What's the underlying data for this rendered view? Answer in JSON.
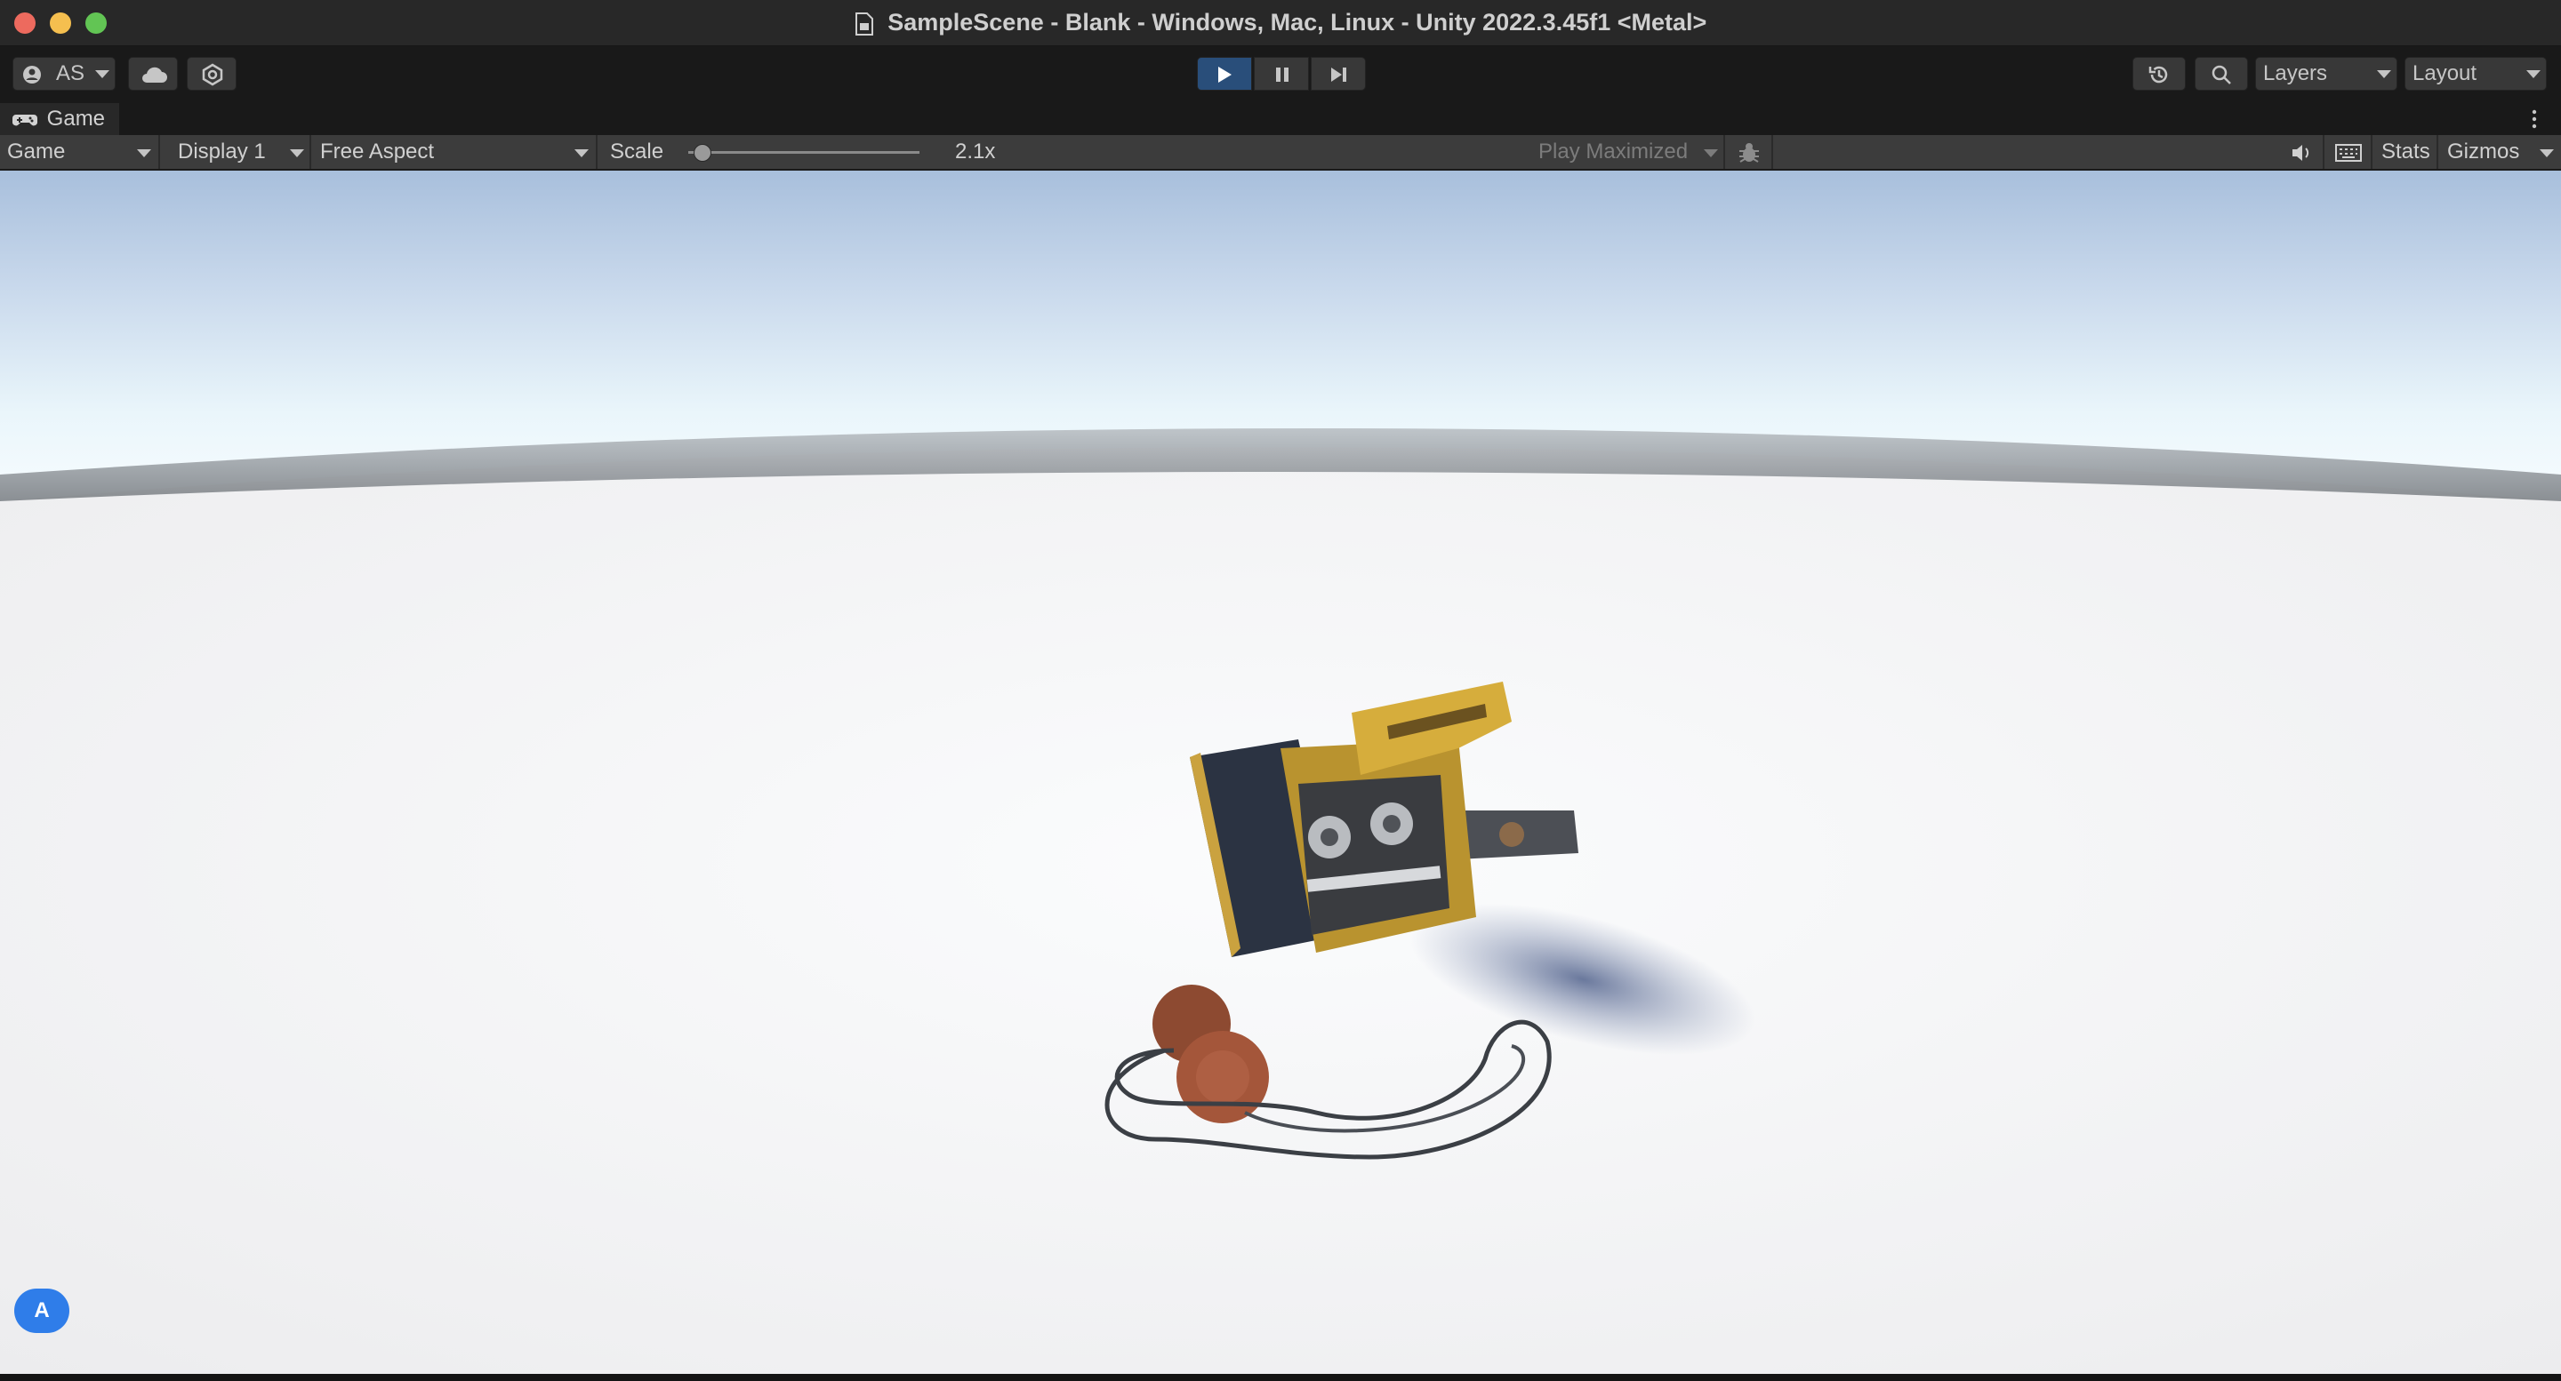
{
  "window": {
    "title": "SampleScene - Blank - Windows, Mac, Linux - Unity 2022.3.45f1 <Metal>"
  },
  "toolbar": {
    "account_label": "AS",
    "layers_label": "Layers",
    "layout_label": "Layout"
  },
  "tab": {
    "label": "Game"
  },
  "game_toolbar": {
    "mode": "Game",
    "display": "Display 1",
    "aspect": "Free Aspect",
    "scale_label": "Scale",
    "scale_value": "2.1x",
    "scale_fraction": 0.06,
    "play_mode": "Play Maximized",
    "stats_label": "Stats",
    "gizmos_label": "Gizmos"
  },
  "overlay": {
    "badge_label": "A"
  },
  "colors": {
    "play_active": "#294e7a",
    "accent_blue": "#2f7de9"
  },
  "icons": [
    "document-icon",
    "account-icon",
    "cloud-icon",
    "collab-icon",
    "play-icon",
    "pause-icon",
    "step-icon",
    "history-icon",
    "search-icon",
    "gamepad-icon",
    "more-icon",
    "bug-icon",
    "audio-icon",
    "keyboard-icon"
  ]
}
